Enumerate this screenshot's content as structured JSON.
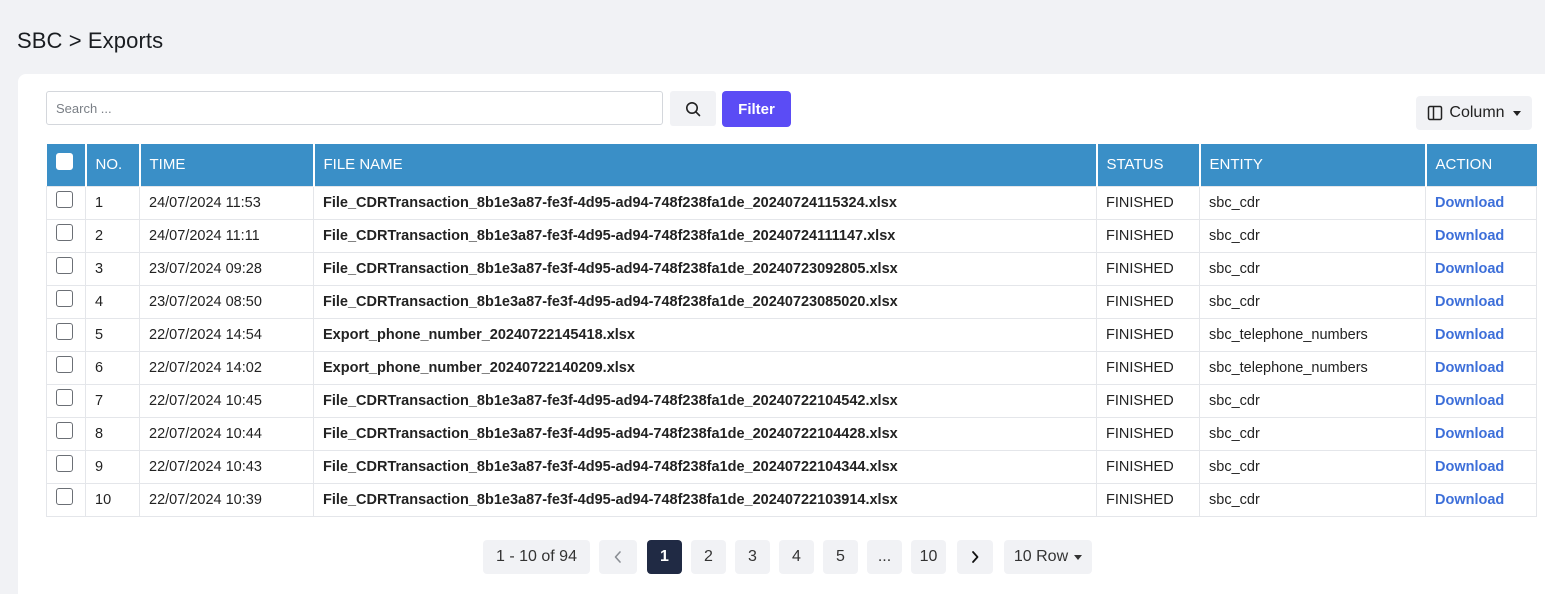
{
  "breadcrumb": "SBC > Exports",
  "search": {
    "placeholder": "Search ...",
    "value": ""
  },
  "toolbar": {
    "filter_label": "Filter",
    "column_label": "Column"
  },
  "table": {
    "headers": [
      "NO.",
      "TIME",
      "FILE NAME",
      "STATUS",
      "ENTITY",
      "ACTION"
    ],
    "rows": [
      {
        "no": "1",
        "time": "24/07/2024 11:53",
        "file": "File_CDRTransaction_8b1e3a87-fe3f-4d95-ad94-748f238fa1de_20240724115324.xlsx",
        "status": "FINISHED",
        "entity": "sbc_cdr",
        "action": "Download"
      },
      {
        "no": "2",
        "time": "24/07/2024 11:11",
        "file": "File_CDRTransaction_8b1e3a87-fe3f-4d95-ad94-748f238fa1de_20240724111147.xlsx",
        "status": "FINISHED",
        "entity": "sbc_cdr",
        "action": "Download"
      },
      {
        "no": "3",
        "time": "23/07/2024 09:28",
        "file": "File_CDRTransaction_8b1e3a87-fe3f-4d95-ad94-748f238fa1de_20240723092805.xlsx",
        "status": "FINISHED",
        "entity": "sbc_cdr",
        "action": "Download"
      },
      {
        "no": "4",
        "time": "23/07/2024 08:50",
        "file": "File_CDRTransaction_8b1e3a87-fe3f-4d95-ad94-748f238fa1de_20240723085020.xlsx",
        "status": "FINISHED",
        "entity": "sbc_cdr",
        "action": "Download"
      },
      {
        "no": "5",
        "time": "22/07/2024 14:54",
        "file": "Export_phone_number_20240722145418.xlsx",
        "status": "FINISHED",
        "entity": "sbc_telephone_numbers",
        "action": "Download"
      },
      {
        "no": "6",
        "time": "22/07/2024 14:02",
        "file": "Export_phone_number_20240722140209.xlsx",
        "status": "FINISHED",
        "entity": "sbc_telephone_numbers",
        "action": "Download"
      },
      {
        "no": "7",
        "time": "22/07/2024 10:45",
        "file": "File_CDRTransaction_8b1e3a87-fe3f-4d95-ad94-748f238fa1de_20240722104542.xlsx",
        "status": "FINISHED",
        "entity": "sbc_cdr",
        "action": "Download"
      },
      {
        "no": "8",
        "time": "22/07/2024 10:44",
        "file": "File_CDRTransaction_8b1e3a87-fe3f-4d95-ad94-748f238fa1de_20240722104428.xlsx",
        "status": "FINISHED",
        "entity": "sbc_cdr",
        "action": "Download"
      },
      {
        "no": "9",
        "time": "22/07/2024 10:43",
        "file": "File_CDRTransaction_8b1e3a87-fe3f-4d95-ad94-748f238fa1de_20240722104344.xlsx",
        "status": "FINISHED",
        "entity": "sbc_cdr",
        "action": "Download"
      },
      {
        "no": "10",
        "time": "22/07/2024 10:39",
        "file": "File_CDRTransaction_8b1e3a87-fe3f-4d95-ad94-748f238fa1de_20240722103914.xlsx",
        "status": "FINISHED",
        "entity": "sbc_cdr",
        "action": "Download"
      }
    ]
  },
  "pagination": {
    "range_label": "1 - 10 of 94",
    "pages": [
      "1",
      "2",
      "3",
      "4",
      "5",
      "...",
      "10"
    ],
    "current_page": "1",
    "rows_label": "10 Row"
  },
  "colors": {
    "header_bg": "#3a8fc7",
    "accent": "#5b4cf5",
    "link": "#3d6fd9",
    "active_page": "#202a44"
  },
  "icons": {
    "search": "search-icon",
    "column": "columns-icon",
    "prev": "chevron-left-icon",
    "next": "chevron-right-icon"
  }
}
